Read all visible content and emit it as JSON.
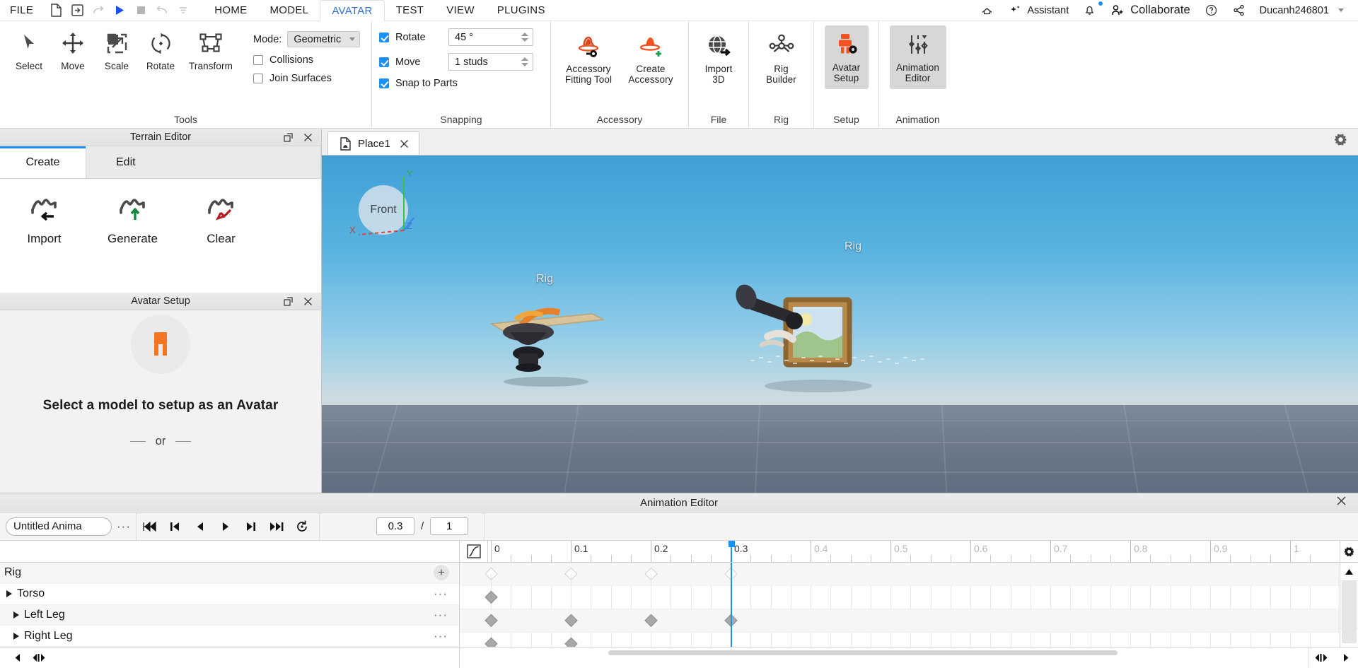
{
  "topbar": {
    "file_label": "FILE",
    "quick_icons": [
      {
        "name": "new-document-icon"
      },
      {
        "name": "open-file-icon"
      },
      {
        "name": "redo-arrow-icon"
      },
      {
        "name": "play-icon"
      },
      {
        "name": "stop-icon"
      },
      {
        "name": "undo-icon"
      },
      {
        "name": "more-options-icon"
      }
    ],
    "tabs": [
      {
        "label": "HOME",
        "active": false
      },
      {
        "label": "MODEL",
        "active": false
      },
      {
        "label": "AVATAR",
        "active": true
      },
      {
        "label": "TEST",
        "active": false
      },
      {
        "label": "VIEW",
        "active": false
      },
      {
        "label": "PLUGINS",
        "active": false
      }
    ],
    "right_items": [
      {
        "label": "",
        "icon": "home-cloud-icon"
      },
      {
        "label": "Assistant",
        "icon": "sparkle-icon"
      },
      {
        "label": "",
        "icon": "notification-bell-icon"
      },
      {
        "label": "Collaborate",
        "icon": "add-person-icon"
      },
      {
        "label": "",
        "icon": "help-question-icon"
      },
      {
        "label": "",
        "icon": "share-icon"
      },
      {
        "label": "Ducanh246801",
        "icon": "user-caret-icon"
      }
    ],
    "username": "Ducanh246801"
  },
  "ribbon": {
    "groups": [
      {
        "title": "Tools",
        "buttons": [
          {
            "label": "Select",
            "icon": "cursor-arrow-icon"
          },
          {
            "label": "Move",
            "icon": "move-arrows-icon"
          },
          {
            "label": "Scale",
            "icon": "scale-icon"
          },
          {
            "label": "Rotate",
            "icon": "rotate-icon"
          },
          {
            "label": "Transform",
            "icon": "transform-icon"
          }
        ],
        "mode_label": "Mode:",
        "mode_value": "Geometric",
        "checkboxes": [
          {
            "label": "Collisions",
            "checked": false
          },
          {
            "label": "Join Surfaces",
            "checked": false
          }
        ]
      },
      {
        "title": "Snapping",
        "rows": [
          {
            "label": "Rotate",
            "checked": true,
            "value": "45 °"
          },
          {
            "label": "Move",
            "checked": true,
            "value": "1 studs"
          }
        ],
        "snap_to_parts": {
          "label": "Snap to Parts",
          "checked": true
        }
      },
      {
        "title": "Accessory",
        "buttons": [
          {
            "label": "Accessory\nFitting Tool",
            "line1": "Accessory",
            "line2": "Fitting Tool",
            "icon": "hat-fitting-icon"
          },
          {
            "label": "Create Accessory",
            "line1": "Create",
            "line2": "Accessory",
            "icon": "hat-plus-icon"
          }
        ]
      },
      {
        "title": "File",
        "buttons": [
          {
            "label": "Import 3D",
            "line1": "Import",
            "line2": "3D",
            "icon": "globe-import-icon"
          }
        ]
      },
      {
        "title": "Rig",
        "buttons": [
          {
            "label": "Rig Builder",
            "line1": "Rig",
            "line2": "Builder",
            "icon": "rig-builder-icon"
          }
        ]
      },
      {
        "title": "Setup",
        "buttons": [
          {
            "label": "Avatar Setup",
            "line1": "Avatar",
            "line2": "Setup",
            "icon": "avatar-setup-icon",
            "selected": true
          }
        ]
      },
      {
        "title": "Animation",
        "buttons": [
          {
            "label": "Animation Editor",
            "line1": "Animation",
            "line2": "Editor",
            "icon": "animation-editor-icon",
            "selected": true
          }
        ]
      }
    ]
  },
  "terrain_panel": {
    "title": "Terrain Editor",
    "tabs": [
      {
        "label": "Create",
        "active": true
      },
      {
        "label": "Edit",
        "active": false
      }
    ],
    "buttons": [
      {
        "label": "Import",
        "icon": "terrain-import-icon"
      },
      {
        "label": "Generate",
        "icon": "terrain-generate-icon"
      },
      {
        "label": "Clear",
        "icon": "terrain-clear-icon"
      }
    ]
  },
  "avatar_panel": {
    "title": "Avatar Setup",
    "message": "Select a model to setup as an Avatar",
    "or_text": "or"
  },
  "viewport": {
    "tab_label": "Place1",
    "gizmo_label": "Front",
    "axis_x": "X",
    "axis_y": "Y",
    "axis_z": "Z",
    "rig_labels": [
      "Rig",
      "Rig"
    ]
  },
  "animation_editor": {
    "title": "Animation Editor",
    "animation_name": "Untitled Anima",
    "current_time": "0.3",
    "total_time": "1",
    "playback_buttons": [
      {
        "name": "skip-to-start-button",
        "glyph": "skip-start"
      },
      {
        "name": "previous-keyframe-button",
        "glyph": "prev-frame"
      },
      {
        "name": "step-back-button",
        "glyph": "step-back"
      },
      {
        "name": "play-button",
        "glyph": "play"
      },
      {
        "name": "next-keyframe-button",
        "glyph": "next-frame"
      },
      {
        "name": "skip-to-end-button",
        "glyph": "skip-end"
      },
      {
        "name": "loop-button",
        "glyph": "loop"
      }
    ],
    "tracks": [
      {
        "name": "Rig",
        "indent": 0,
        "expandable": false,
        "root": true
      },
      {
        "name": "Torso",
        "indent": 0,
        "expandable": true
      },
      {
        "name": "Left Leg",
        "indent": 1,
        "expandable": true
      },
      {
        "name": "Right Leg",
        "indent": 1,
        "expandable": true
      }
    ],
    "ruler_labels": [
      "0",
      "0.1",
      "0.2",
      "0.3",
      "0.4",
      "0.5",
      "0.6",
      "0.7",
      "0.8",
      "0.9",
      "1"
    ],
    "ruler_dim_from": 4,
    "keyframes": {
      "Rig": [
        0,
        0.1,
        0.2,
        0.3
      ],
      "Torso": [
        0
      ],
      "Left Leg": [
        0,
        0.1,
        0.2,
        0.3
      ],
      "Right Leg": [
        0,
        0.1
      ]
    },
    "playhead_time": 0.3,
    "time_range": [
      0,
      1
    ]
  },
  "colors": {
    "accent_blue": "#1d90f5",
    "tab_active": "#2f6fd0",
    "hat_orange": "#e5572a",
    "avatar_orange": "#f26a21",
    "green_plus": "#179e4e"
  }
}
